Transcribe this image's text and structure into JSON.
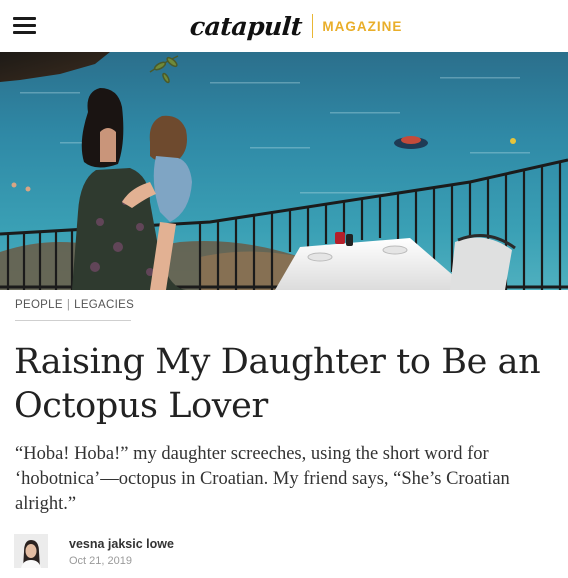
{
  "header": {
    "menu_icon": "hamburger-menu-icon",
    "logo_word": "catapult",
    "logo_section": "MAGAZINE",
    "accent_color": "#e9ae2a"
  },
  "hero": {
    "description_icon": "hero-photo"
  },
  "article": {
    "categories": [
      "PEOPLE",
      "LEGACIES"
    ],
    "category_separator": "|",
    "title": "Raising My Daughter to Be an Octopus Lover",
    "dek": "“Hoba! Hoba!” my daughter screeches, using the short word for ‘hobotnica’—octopus in Croatian. My friend says, “She’s Croatian alright.”",
    "author": "vesna jaksic lowe",
    "date": "Oct 21, 2019"
  }
}
